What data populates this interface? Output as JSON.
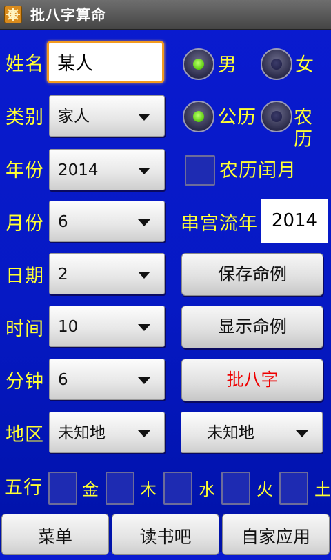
{
  "title_bar": {
    "title": "批八字算命",
    "icon": "ship-wheel-icon"
  },
  "form": {
    "name_label": "姓名",
    "name_value": "某人",
    "category_label": "类别",
    "category_value": "家人",
    "year_label": "年份",
    "year_value": "2014",
    "month_label": "月份",
    "month_value": "6",
    "day_label": "日期",
    "day_value": "2",
    "hour_label": "时间",
    "hour_value": "10",
    "minute_label": "分钟",
    "minute_value": "6",
    "region_label": "地区",
    "region_value": "未知地",
    "region2_value": "未知地"
  },
  "gender": {
    "male": "男",
    "female": "女",
    "selected": "男"
  },
  "calendar": {
    "solar": "公历",
    "lunar": "农历",
    "selected": "公历"
  },
  "leap_month": {
    "label": "农历闰月",
    "checked": false
  },
  "flow_year": {
    "label": "串宫流年",
    "value": "2014"
  },
  "buttons": {
    "save": "保存命例",
    "show": "显示命例",
    "calc": "批八字"
  },
  "colors": {
    "accent_text": "#ffff33",
    "calc_text": "#ee0000",
    "background": "#0619c4"
  },
  "wuxing": {
    "label": "五行",
    "items": [
      "金",
      "木",
      "水",
      "火",
      "土"
    ]
  },
  "bottom": {
    "menu": "菜单",
    "read": "读书吧",
    "apps": "自家应用"
  }
}
